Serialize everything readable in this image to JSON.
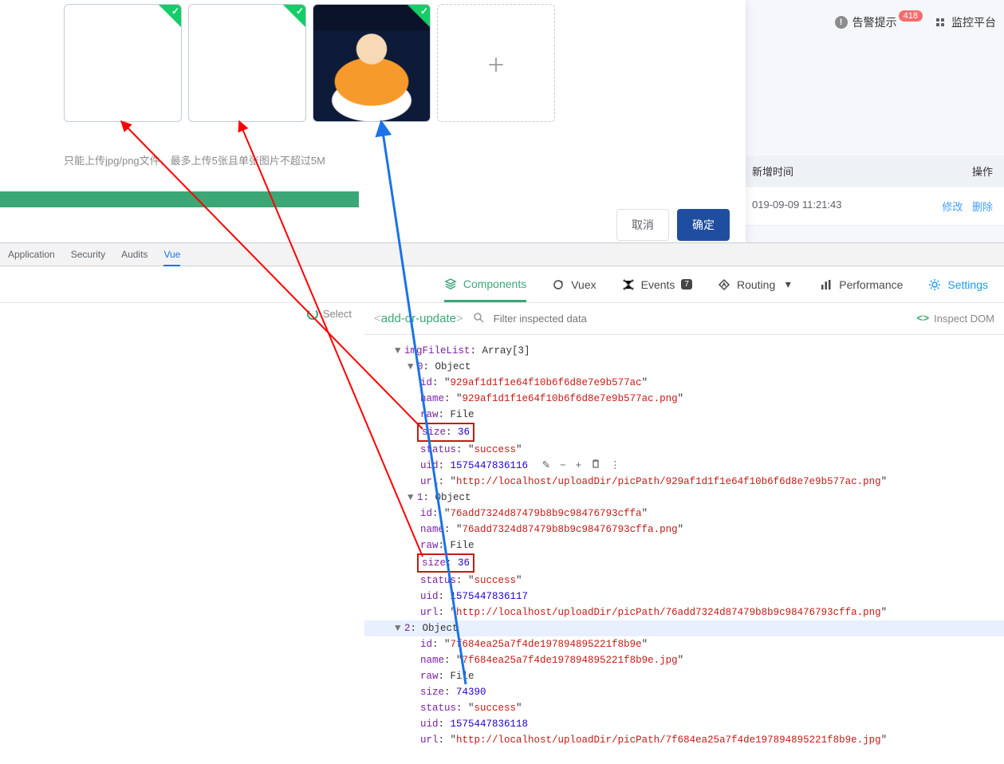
{
  "dialog": {
    "hint": "只能上传jpg/png文件，最多上传5张且单张图片不超过5M",
    "cancel": "取消",
    "confirm": "确定"
  },
  "bg": {
    "alert_label": "告警提示",
    "alert_count": "418",
    "platform": "监控平台",
    "th_time": "新增时间",
    "th_op": "操作",
    "row1_time": "019-09-09 11:21:43",
    "edit": "修改",
    "delete": "删除"
  },
  "devtabs": {
    "application": "Application",
    "security": "Security",
    "audits": "Audits",
    "vue": "Vue"
  },
  "vuenav": {
    "components": "Components",
    "vuex": "Vuex",
    "events": "Events",
    "events_badge": "7",
    "routing": "Routing",
    "performance": "Performance",
    "settings": "Settings"
  },
  "leftpane": {
    "select": "Select"
  },
  "inspector": {
    "component": "add-or-update",
    "filter_placeholder": "Filter inspected data",
    "inspect": "Inspect DOM",
    "root_key": "imgFileList",
    "root_type": "Array[3]",
    "items": [
      {
        "idx": "0",
        "type": "Object",
        "id": "929af1d1f1e64f10b6f6d8e7e9b577ac",
        "name": "929af1d1f1e64f10b6f6d8e7e9b577ac.png",
        "raw": "File",
        "size": "36",
        "status": "success",
        "uid": "1575447836116",
        "url": "http://localhost/uploadDir/picPath/929af1d1f1e64f10b6f6d8e7e9b577ac.png"
      },
      {
        "idx": "1",
        "type": "Object",
        "id": "76add7324d87479b8b9c98476793cffa",
        "name": "76add7324d87479b8b9c98476793cffa.png",
        "raw": "File",
        "size": "36",
        "status": "success",
        "uid": "1575447836117",
        "url": "http://localhost/uploadDir/picPath/76add7324d87479b8b9c98476793cffa.png"
      },
      {
        "idx": "2",
        "type": "Object",
        "id": "7f684ea25a7f4de197894895221f8b9e",
        "name": "7f684ea25a7f4de197894895221f8b9e.jpg",
        "raw": "File",
        "size": "74390",
        "status": "success",
        "uid": "1575447836118",
        "url": "http://localhost/uploadDir/picPath/7f684ea25a7f4de197894895221f8b9e.jpg"
      }
    ]
  }
}
